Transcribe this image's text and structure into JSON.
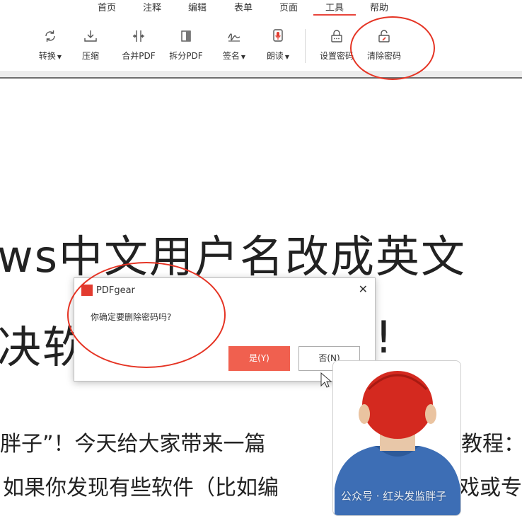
{
  "menu": {
    "tabs": [
      "首页",
      "注释",
      "编辑",
      "表单",
      "页面",
      "工具",
      "帮助"
    ],
    "active": "工具"
  },
  "toolbar": {
    "tools": [
      {
        "label": "转换",
        "icon": "convert-icon",
        "dropdown": true
      },
      {
        "label": "压缩",
        "icon": "compress-icon",
        "dropdown": false
      },
      {
        "label": "合并PDF",
        "icon": "merge-pdf-icon",
        "dropdown": false
      },
      {
        "label": "拆分PDF",
        "icon": "split-pdf-icon",
        "dropdown": false
      },
      {
        "label": "签名",
        "icon": "signature-icon",
        "dropdown": true
      },
      {
        "label": "朗读",
        "icon": "microphone-icon",
        "dropdown": true
      },
      {
        "label": "设置密码",
        "icon": "lock-icon",
        "dropdown": false
      },
      {
        "label": "清除密码",
        "icon": "unlock-icon",
        "dropdown": false
      }
    ],
    "caret": "▼"
  },
  "document": {
    "heading_line1": "ws中文用户名改成英文",
    "heading_line2_left": "决软",
    "heading_line2_right": "!",
    "body_line1_left": "胖子”！今天给大家带来一篇",
    "body_line1_right": "教程：",
    "body_line2_left": "如果你发现有些软件（比如编",
    "body_line2_right": "戏或专"
  },
  "dialog": {
    "title": "PDFgear",
    "close_glyph": "✕",
    "message": "你确定要删除密码吗?",
    "yes_label": "是(Y)",
    "no_label": "否(N)"
  },
  "watermark": "公众号 · 红头发监胖子",
  "colors": {
    "accent": "#e8453c",
    "annotation": "#e53424",
    "primary_button": "#f0604f"
  }
}
